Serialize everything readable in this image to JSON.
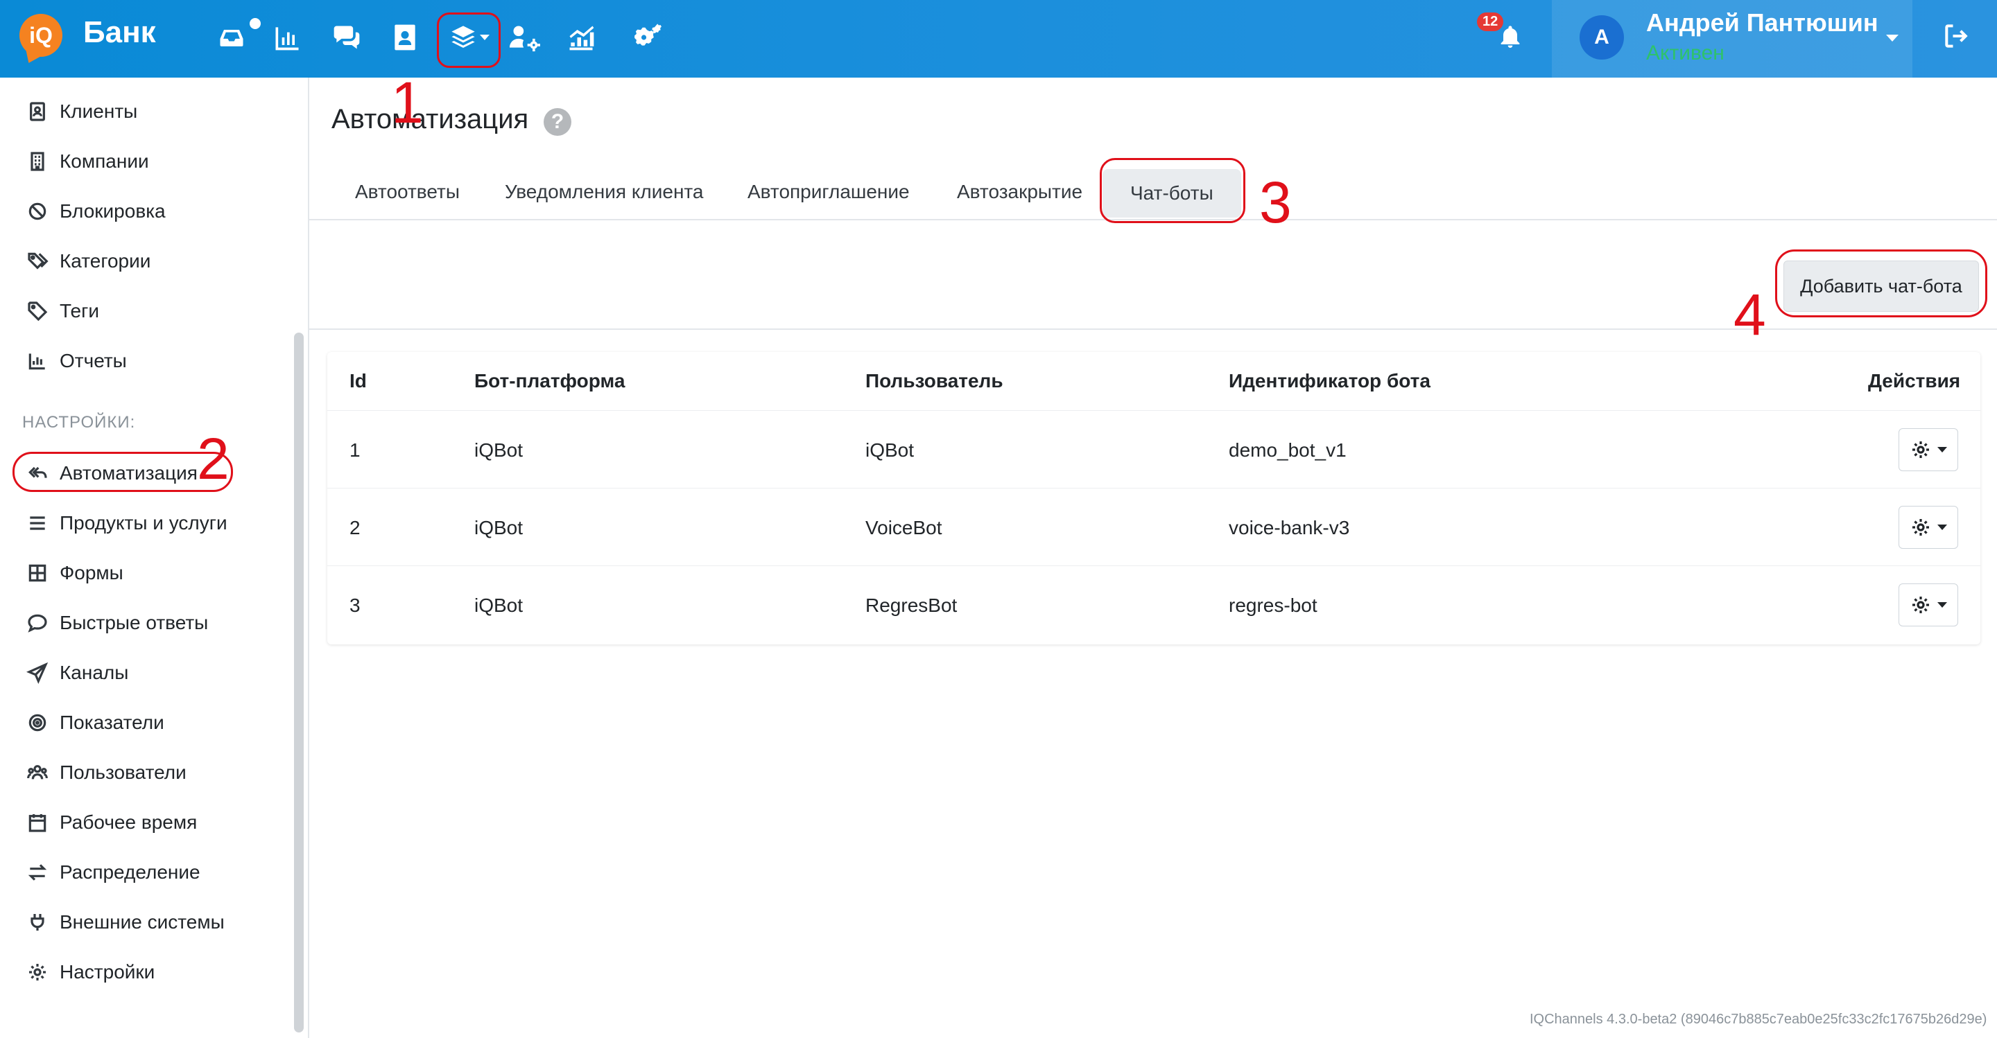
{
  "header": {
    "logo_text": "iQ",
    "brand": "Банк",
    "nav_icons": [
      "inbox-icon",
      "chart-bars-icon",
      "chat-icon",
      "contacts-icon",
      "layers-icon",
      "user-cog-icon",
      "analytics-icon",
      "cogs-icon"
    ],
    "notifications_count": "12",
    "user": {
      "initial": "А",
      "name": "Андрей Пантюшин",
      "status": "Активен"
    }
  },
  "sidebar": {
    "items_top": [
      {
        "label": "Клиенты",
        "icon": "address-book-icon"
      },
      {
        "label": "Компании",
        "icon": "building-icon"
      },
      {
        "label": "Блокировка",
        "icon": "ban-icon"
      },
      {
        "label": "Категории",
        "icon": "tags-icon"
      },
      {
        "label": "Теги",
        "icon": "tag-icon"
      },
      {
        "label": "Отчеты",
        "icon": "bar-chart-icon"
      }
    ],
    "section_label": "НАСТРОЙКИ:",
    "items_settings": [
      {
        "label": "Автоматизация",
        "icon": "reply-all-icon"
      },
      {
        "label": "Продукты и услуги",
        "icon": "list-icon"
      },
      {
        "label": "Формы",
        "icon": "grid-icon"
      },
      {
        "label": "Быстрые ответы",
        "icon": "comment-dots-icon"
      },
      {
        "label": "Каналы",
        "icon": "paper-plane-icon"
      },
      {
        "label": "Показатели",
        "icon": "target-icon"
      },
      {
        "label": "Пользователи",
        "icon": "users-icon"
      },
      {
        "label": "Рабочее время",
        "icon": "calendar-icon"
      },
      {
        "label": "Распределение",
        "icon": "exchange-icon"
      },
      {
        "label": "Внешние системы",
        "icon": "plug-icon"
      },
      {
        "label": "Настройки",
        "icon": "gear-icon"
      }
    ]
  },
  "main": {
    "title": "Автоматизация",
    "help": "?",
    "tabs": [
      "Автоответы",
      "Уведомления клиента",
      "Автоприглашение",
      "Автозакрытие",
      "Чат-боты"
    ],
    "active_tab": "Чат-боты",
    "add_button": "Добавить чат-бота",
    "table": {
      "headers": [
        "Id",
        "Бот-платформа",
        "Пользователь",
        "Идентификатор бота",
        "Действия"
      ],
      "rows": [
        [
          "1",
          "iQBot",
          "iQBot",
          "demo_bot_v1"
        ],
        [
          "2",
          "iQBot",
          "VoiceBot",
          "voice-bank-v3"
        ],
        [
          "3",
          "iQBot",
          "RegresBot",
          "regres-bot"
        ]
      ]
    }
  },
  "footer": {
    "version": "IQChannels 4.3.0-beta2 (89046c7b885c7eab0e25fc33c2fc17675b26d29e)"
  },
  "annotations": [
    "1",
    "2",
    "3",
    "4"
  ],
  "colors": {
    "header": "#0a8ad6",
    "logo": "#f58220",
    "status_online": "#2ec26b",
    "annotation": "#e0101a"
  }
}
